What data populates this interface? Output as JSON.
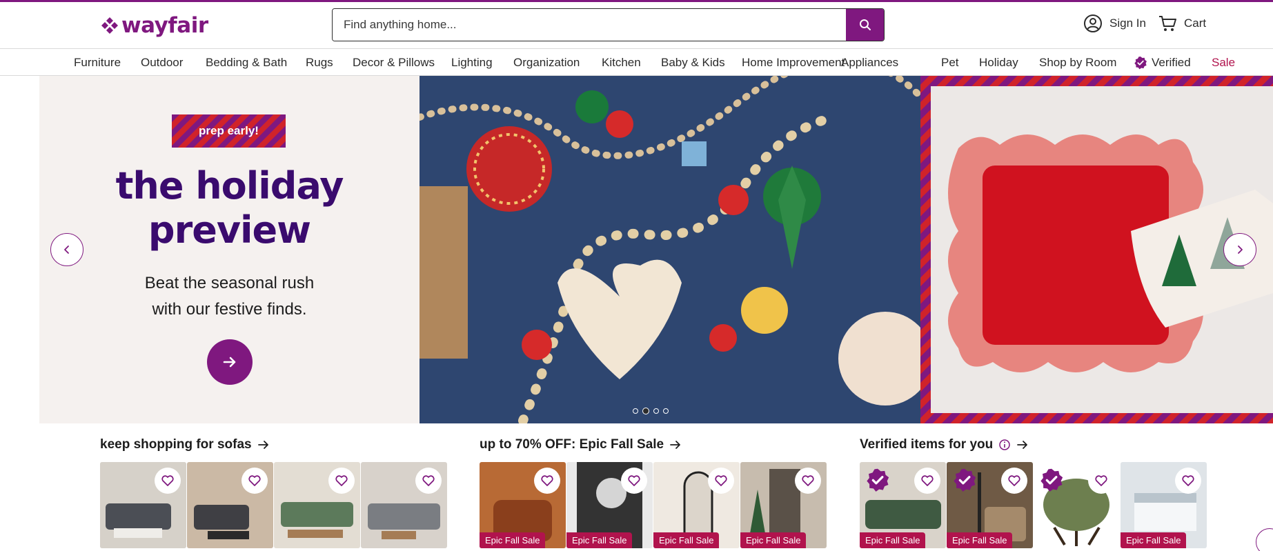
{
  "header": {
    "logo_text": "wayfair",
    "search_placeholder": "Find anything home...",
    "sign_in": "Sign In",
    "cart": "Cart"
  },
  "nav": {
    "items": [
      "Furniture",
      "Outdoor",
      "Bedding & Bath",
      "Rugs",
      "Decor & Pillows",
      "Lighting",
      "Organization",
      "Kitchen",
      "Baby & Kids",
      "Home Improvement",
      "Appliances",
      "Pet",
      "Holiday",
      "Shop by Room",
      "Verified",
      "Sale"
    ]
  },
  "hero": {
    "tag": "prep early!",
    "title_line1": "the holiday",
    "title_line2": "preview",
    "subtitle_line1": "Beat the seasonal rush",
    "subtitle_line2": "with our festive finds.",
    "slide_count": 4,
    "active_slide": 2
  },
  "rows": [
    {
      "title": "keep shopping for sofas",
      "tiles": [
        {
          "badge": ""
        },
        {
          "badge": ""
        },
        {
          "badge": ""
        },
        {
          "badge": ""
        }
      ]
    },
    {
      "title": "up to 70% OFF: Epic Fall Sale",
      "tiles": [
        {
          "badge": "Epic Fall Sale"
        },
        {
          "badge": "Epic Fall Sale"
        },
        {
          "badge": "Epic Fall Sale"
        },
        {
          "badge": "Epic Fall Sale"
        }
      ]
    },
    {
      "title": "Verified items for you",
      "tiles": [
        {
          "badge": "Epic Fall Sale"
        },
        {
          "badge": "Epic Fall Sale"
        },
        {
          "badge": ""
        },
        {
          "badge": "Epic Fall Sale"
        }
      ]
    }
  ],
  "colors": {
    "brand": "#7f187f",
    "sale": "#b1134d",
    "hero_title": "#3a0b6e"
  }
}
